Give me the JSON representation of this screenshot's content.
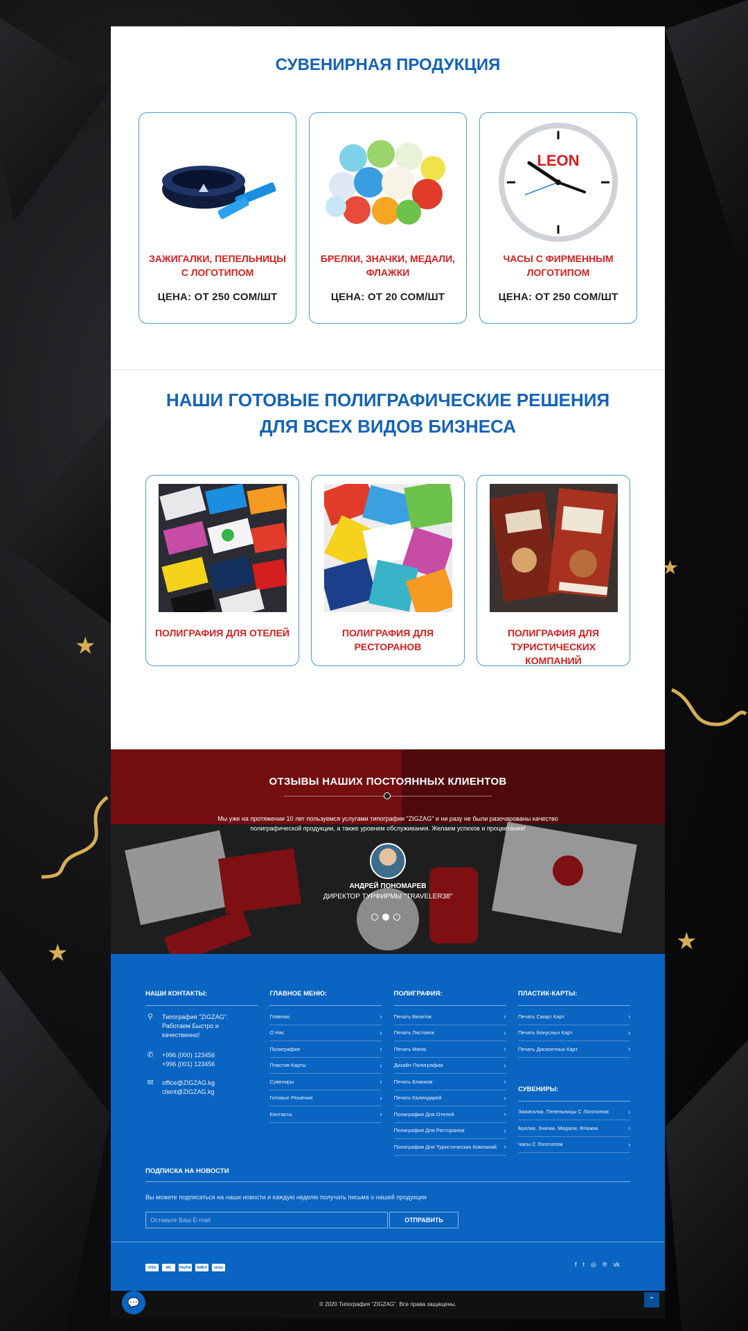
{
  "souvenirs": {
    "title": "СУВЕНИРНАЯ ПРОДУКЦИЯ",
    "items": [
      {
        "name": "ЗАЖИГАЛКИ, ПЕПЕЛЬНИЦЫ С ЛОГОТИПОМ",
        "price": "ЦЕНА: ОТ 250 СОМ/ШТ"
      },
      {
        "name": "БРЕЛКИ, ЗНАЧКИ, МЕДАЛИ, ФЛАЖКИ",
        "price": "ЦЕНА: ОТ 20 СОМ/ШТ"
      },
      {
        "name": "ЧАСЫ С ФИРМЕННЫМ ЛОГОТИПОМ",
        "price": "ЦЕНА: ОТ 250 СОМ/ШТ",
        "clock_brand": "LEON"
      }
    ]
  },
  "solutions": {
    "title": "НАШИ ГОТОВЫЕ ПОЛИГРАФИЧЕСКИЕ РЕШЕНИЯ ДЛЯ ВСЕХ ВИДОВ БИЗНЕСА",
    "items": [
      {
        "name": "ПОЛИГРАФИЯ ДЛЯ ОТЕЛЕЙ"
      },
      {
        "name": "ПОЛИГРАФИЯ ДЛЯ РЕСТОРАНОВ"
      },
      {
        "name": "ПОЛИГРАФИЯ ДЛЯ ТУРИСТИЧЕСКИХ КОМПАНИЙ"
      }
    ]
  },
  "reviews": {
    "title": "ОТЗЫВЫ НАШИХ ПОСТОЯННЫХ КЛИЕНТОВ",
    "text": "Мы уже на протяжении 10 лет пользуемся услугами типографии \"ZIGZAG\" и ни разу не были разочарованы качество полиграфической продукции, а также уровнем обслуживания. Желаем успехов и процветания!",
    "author": "АНДРЕЙ ПОНОМАРЕВ",
    "role": "ДИРЕКТОР ТУРФИРМЫ \"TRAVELER38\""
  },
  "footer": {
    "contacts": {
      "title": "НАШИ КОНТАКТЫ:",
      "address": "Типография \"ZIGZAG\". Работаем Быстро и качественно!",
      "phone1": "+996 (000) 123456",
      "phone2": "+996 (001) 123456",
      "email1": "office@ZIGZAG.kg",
      "email2": "client@ZIGZAG.kg"
    },
    "menu": {
      "title": "ГЛАВНОЕ МЕНЮ:",
      "items": [
        "Главная",
        "О Нас",
        "Полиграфия",
        "Пластик-Карты",
        "Сувениры",
        "Готовые Решения",
        "Контакты"
      ]
    },
    "printing": {
      "title": "ПОЛИГРАФИЯ:",
      "items": [
        "Печать Визиток",
        "Печать Листовок",
        "Печать Меню",
        "Дизайн Полиграфии",
        "Печать Бланков",
        "Печать Календарей",
        "Полиграфия Для Отелей",
        "Полиграфия Для Ресторанов",
        "Полиграфия Для Туристических Компаний"
      ]
    },
    "cards": {
      "title": "ПЛАСТИК-КАРТЫ:",
      "items": [
        "Печать Смарт Карт",
        "Печать Бонусных Карт",
        "Печать Дисконтных Карт"
      ]
    },
    "souvenirs": {
      "title": "СУВЕНИРЫ:",
      "items": [
        "Зажигалки, Пепельницы С Логотипом",
        "Брелки, Значки, Медали, Флажки",
        "Часы С Логотипом"
      ]
    },
    "subscribe": {
      "title": "ПОДПИСКА НА НОВОСТИ",
      "text": "Вы можете подписаться на наши новости и каждую неделю получать письма о нашей продукции",
      "placeholder": "Оставьте Ваш E-mail",
      "button": "ОТПРАВИТЬ"
    },
    "payments": [
      "VISA",
      "MC",
      "PayPal",
      "AMEX",
      "stripe"
    ],
    "socials": [
      "facebook-icon",
      "twitter-icon",
      "instagram-icon",
      "pinterest-icon",
      "vk-icon"
    ],
    "copyright": "© 2020 Типография \"ZIGZAG\". Все права защищены."
  },
  "colors": {
    "accent": "#1463b6",
    "red": "#d51e1e",
    "footer": "#0a64c2"
  }
}
